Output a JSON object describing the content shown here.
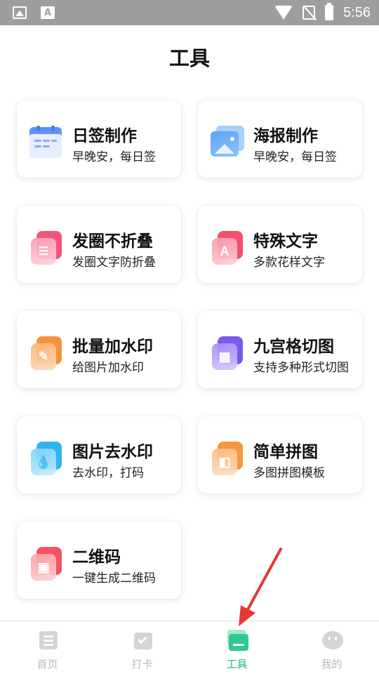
{
  "status_bar": {
    "time": "5:56",
    "font_glyph": "A"
  },
  "header": {
    "title": "工具"
  },
  "tools": [
    {
      "title": "日签制作",
      "subtitle": "早晚安，每日签",
      "icon": "calendar-icon"
    },
    {
      "title": "海报制作",
      "subtitle": "早晚安，每日签",
      "icon": "image-icon"
    },
    {
      "title": "发圈不折叠",
      "subtitle": "发圈文字防折叠",
      "icon": "document-icon"
    },
    {
      "title": "特殊文字",
      "subtitle": "多款花样文字",
      "icon": "letter-a-icon",
      "glyph": "A"
    },
    {
      "title": "批量加水印",
      "subtitle": "给图片加水印",
      "icon": "magic-wand-icon"
    },
    {
      "title": "九宫格切图",
      "subtitle": "支持多种形式切图",
      "icon": "grid-icon"
    },
    {
      "title": "图片去水印",
      "subtitle": "去水印，打码",
      "icon": "droplet-icon"
    },
    {
      "title": "简单拼图",
      "subtitle": "多图拼图模板",
      "icon": "collage-icon"
    },
    {
      "title": "二维码",
      "subtitle": "一键生成二维码",
      "icon": "qr-code-icon"
    }
  ],
  "tab_bar": {
    "active": "工具",
    "items": [
      {
        "label": "首页",
        "icon": "home-icon"
      },
      {
        "label": "打卡",
        "icon": "check-in-icon"
      },
      {
        "label": "工具",
        "icon": "tools-icon"
      },
      {
        "label": "我的",
        "icon": "profile-icon"
      }
    ]
  },
  "colors": {
    "accent": "#1db881",
    "arrow": "#e53935",
    "status_bar": "#9e9e9e"
  }
}
